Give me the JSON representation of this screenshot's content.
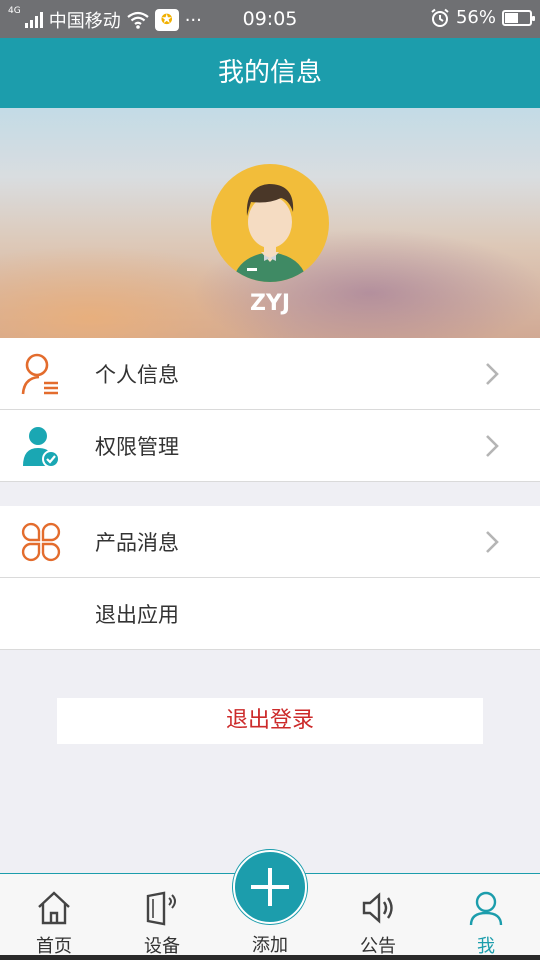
{
  "status_bar": {
    "network_tag": "4G",
    "carrier": "中国移动",
    "app_badge": "✪",
    "more": "···",
    "time": "09:05",
    "battery": "56%",
    "battery_level": 0.56
  },
  "header": {
    "title": "我的信息"
  },
  "profile": {
    "username": "ZYJ"
  },
  "menu_group_1": [
    {
      "label": "个人信息",
      "icon": "person-list-icon"
    },
    {
      "label": "权限管理",
      "icon": "user-check-icon"
    }
  ],
  "menu_group_2": [
    {
      "label": "产品消息",
      "icon": "four-petal-icon"
    },
    {
      "label": "退出应用"
    }
  ],
  "logout_button": "退出登录",
  "tabbar": {
    "home": "首页",
    "devices": "设备",
    "add": "添加",
    "notice": "公告",
    "me": "我"
  },
  "colors": {
    "primary": "#1c9dac",
    "logout": "#cc2a2a",
    "icon_orange": "#e36c2d"
  }
}
